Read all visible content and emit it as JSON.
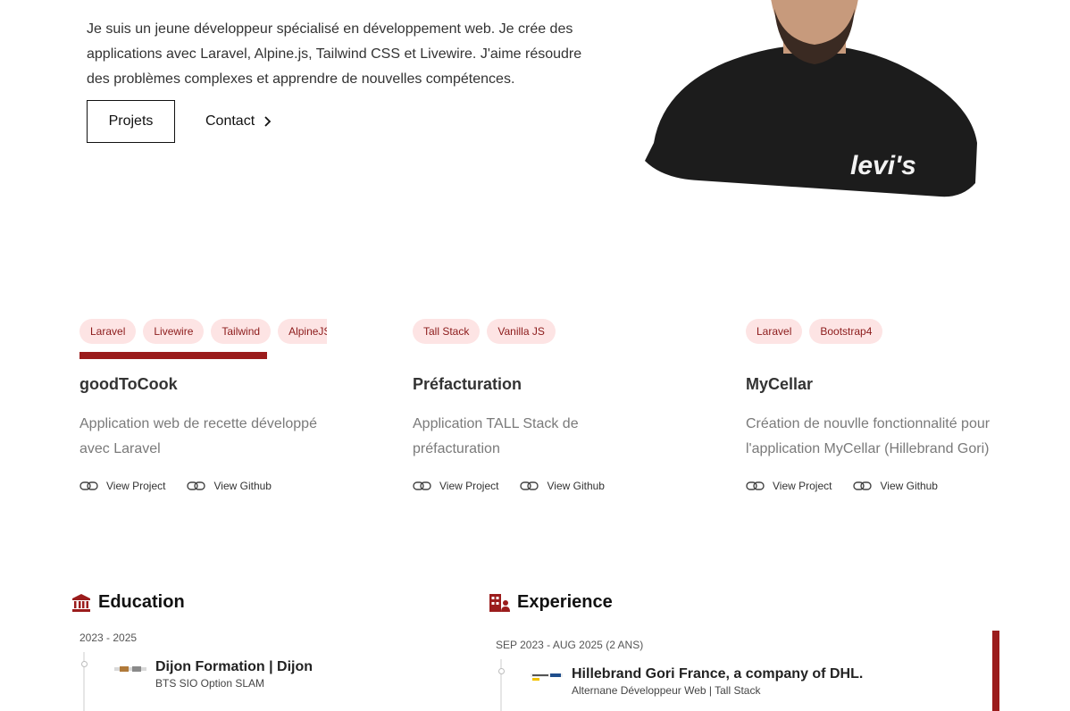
{
  "hero": {
    "intro": "Je suis un jeune développeur spécialisé en développement web. Je crée des applications avec Laravel, Alpine.js, Tailwind CSS et Livewire. J'aime résoudre des problèmes complexes et apprendre de nouvelles compétences.",
    "projects_button": "Projets",
    "contact_button": "Contact"
  },
  "projects": [
    {
      "tags": [
        "Laravel",
        "Livewire",
        "Tailwind",
        "AlpineJS"
      ],
      "title": "goodToCook",
      "description": "Application web de recette développé avec Laravel",
      "view_project": "View Project",
      "view_github": "View Github"
    },
    {
      "tags": [
        "Tall Stack",
        "Vanilla JS"
      ],
      "title": "Préfacturation",
      "description": "Application TALL Stack de préfacturation",
      "view_project": "View Project",
      "view_github": "View Github"
    },
    {
      "tags": [
        "Laravel",
        "Bootstrap4"
      ],
      "title": "MyCellar",
      "description": "Création de nouvlle fonctionnalité pour l'application MyCellar (Hillebrand Gori)",
      "view_project": "View Project",
      "view_github": "View Github"
    }
  ],
  "education": {
    "heading": "Education",
    "period": "2023 - 2025",
    "title": "Dijon Formation | Dijon",
    "subtitle": "BTS SIO Option SLAM"
  },
  "experience": {
    "heading": "Experience",
    "period": "SEP 2023 - AUG 2025 (2 ANS)",
    "title": "Hillebrand Gori France, a company of DHL.",
    "subtitle": "Alternane Développeur Web | Tall Stack"
  },
  "colors": {
    "accent": "#9b1c1c",
    "tag_bg": "#fde4e4",
    "tag_text": "#8c1b1b"
  }
}
